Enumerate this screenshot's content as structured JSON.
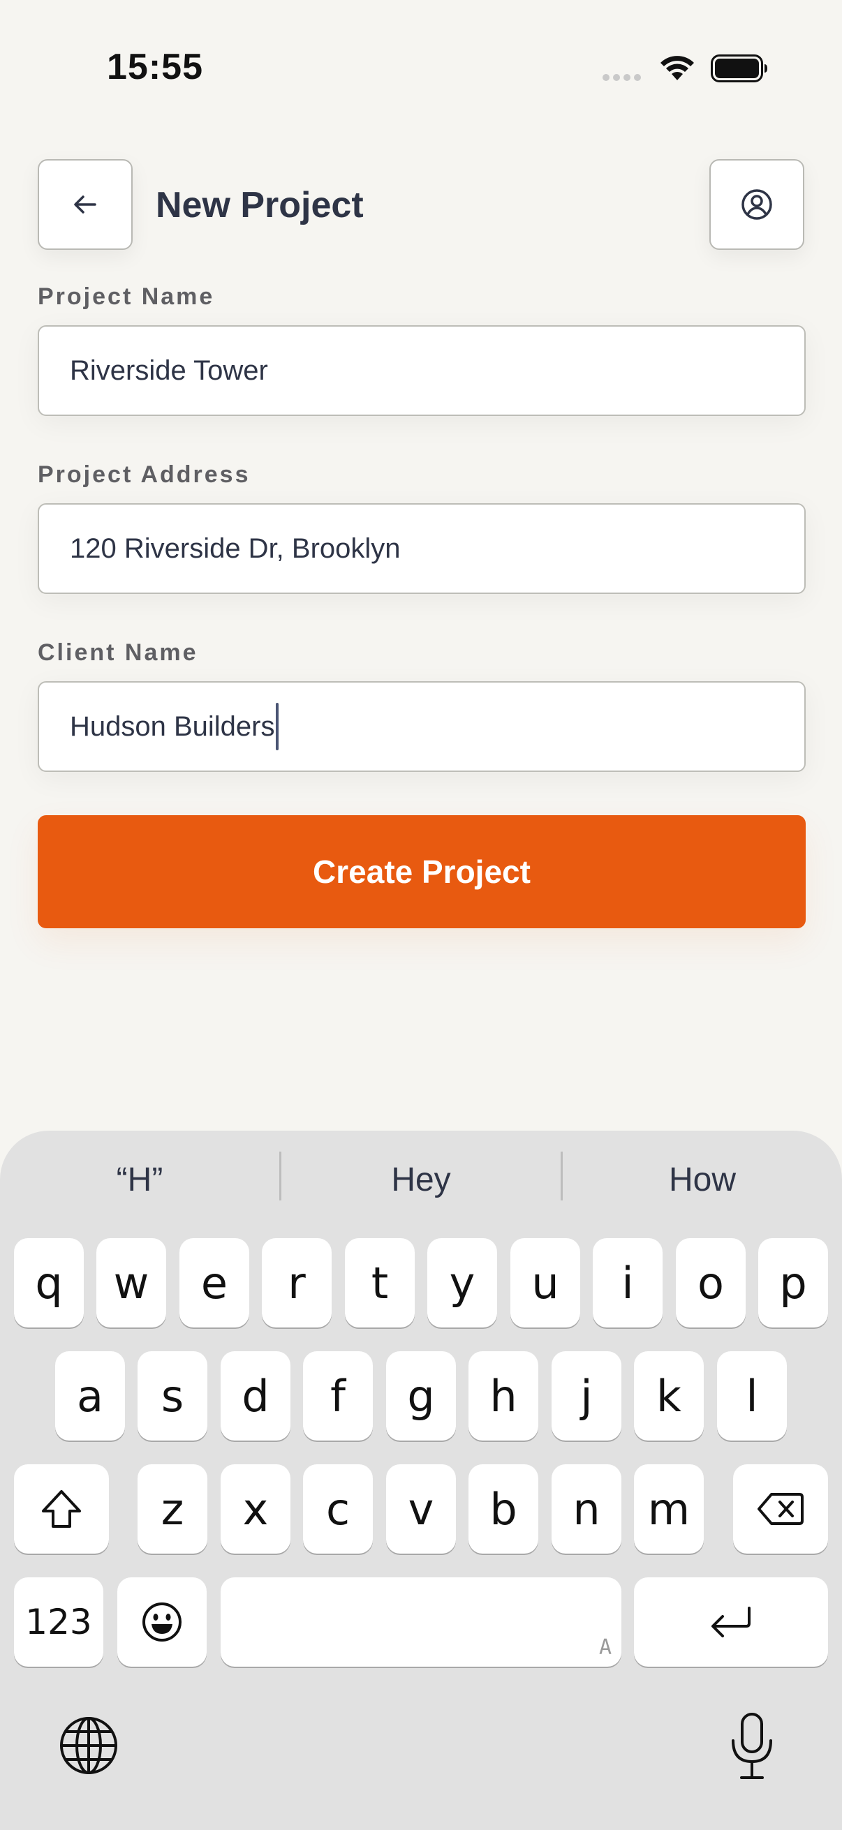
{
  "status_bar": {
    "time": "15:55",
    "icons": [
      "cellular-signal-icon",
      "wifi-icon",
      "battery-icon"
    ]
  },
  "header": {
    "title": "New Project",
    "back_icon": "arrow-left-icon",
    "profile_icon": "user-circle-icon"
  },
  "form": {
    "project_name": {
      "label": "Project Name",
      "value": "Riverside Tower"
    },
    "project_address": {
      "label": "Project Address",
      "value": "120 Riverside Dr, Brooklyn"
    },
    "client_name": {
      "label": "Client Name",
      "value": "Hudson Builders"
    },
    "submit_label": "Create Project"
  },
  "keyboard": {
    "suggestions": [
      "“H”",
      "Hey",
      "How"
    ],
    "row1": [
      "q",
      "w",
      "e",
      "r",
      "t",
      "y",
      "u",
      "i",
      "o",
      "p"
    ],
    "row2": [
      "a",
      "s",
      "d",
      "f",
      "g",
      "h",
      "j",
      "k",
      "l"
    ],
    "row3": [
      "z",
      "x",
      "c",
      "v",
      "b",
      "n",
      "m"
    ],
    "numbers_label": "123",
    "space_hint": "A",
    "icons": [
      "shift-icon",
      "backspace-icon",
      "emoji-icon",
      "return-icon",
      "globe-icon",
      "microphone-icon"
    ]
  },
  "colors": {
    "background": "#f6f5f1",
    "accent": "#e85a10",
    "text": "#2e3446",
    "keyboard_background": "#e1e1e1"
  }
}
